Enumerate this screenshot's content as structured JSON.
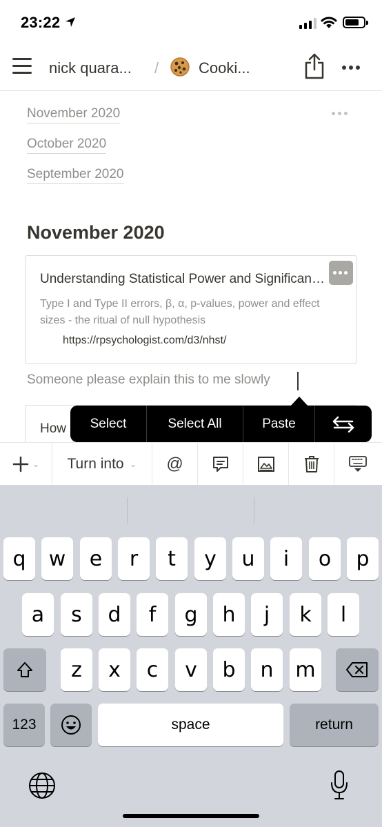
{
  "status_bar": {
    "time": "23:22"
  },
  "nav": {
    "breadcrumb_parent": "nick quara...",
    "breadcrumb_separator": "/",
    "breadcrumb_page": "Cooki..."
  },
  "toc": {
    "links": [
      "November 2020",
      "October 2020",
      "September 2020"
    ]
  },
  "section_heading": "November 2020",
  "bookmark": {
    "title": "Understanding Statistical Power and Significance Testing",
    "description": "Type I and Type II errors, β, α, p-values, power and effect sizes - the ritual of null hypothesis",
    "url": "https://rpsychologist.com/d3/nhst/"
  },
  "paragraph": "Someone please explain this to me slowly",
  "bookmark2": {
    "title": "How"
  },
  "callout_menu": {
    "select": "Select",
    "select_all": "Select All",
    "paste": "Paste"
  },
  "toolbar": {
    "turn_into": "Turn into",
    "mention": "@"
  },
  "keyboard": {
    "row1": [
      "q",
      "w",
      "e",
      "r",
      "t",
      "y",
      "u",
      "i",
      "o",
      "p"
    ],
    "row2": [
      "a",
      "s",
      "d",
      "f",
      "g",
      "h",
      "j",
      "k",
      "l"
    ],
    "row3": [
      "z",
      "x",
      "c",
      "v",
      "b",
      "n",
      "m"
    ],
    "numbers_key": "123",
    "space_key": "space",
    "return_key": "return"
  },
  "colors": {
    "text": "#37352f",
    "muted": "#8f8e8a",
    "keyboard_bg": "#d2d5db",
    "callout_bg": "#000000"
  }
}
